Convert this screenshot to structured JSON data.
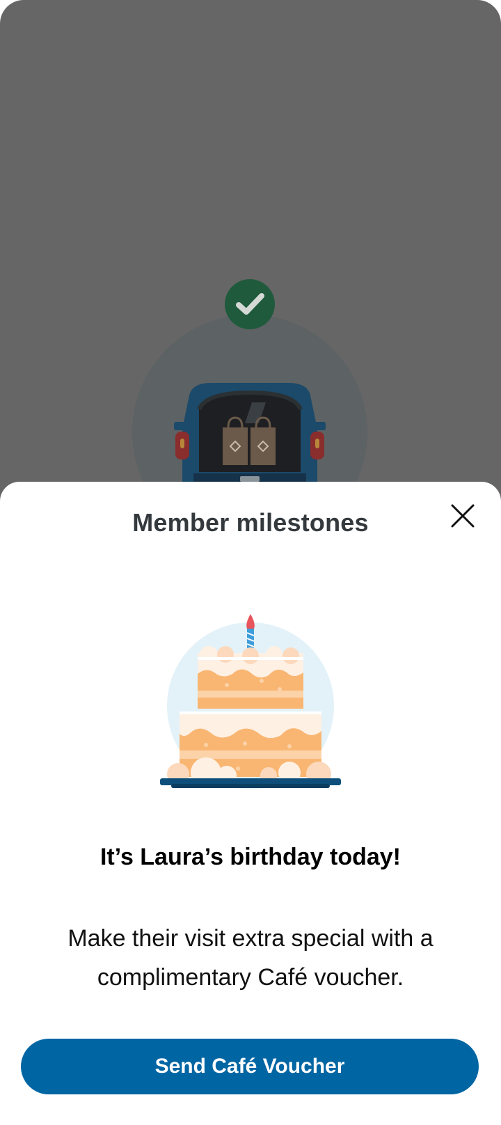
{
  "backdrop": {
    "illustration": "car-trunk-pickup-illustration",
    "badge_icon": "check-icon"
  },
  "sheet": {
    "title": "Member milestones",
    "close_icon": "close-icon",
    "illustration": "birthday-cake-illustration",
    "headline": "It’s Laura’s birthday today!",
    "body": "Make their visit extra special with a complimentary Café voucher.",
    "cta_label": "Send Café Voucher"
  },
  "colors": {
    "backdrop": "#666666",
    "success_badge": "#1f5a3c",
    "primary_button": "#0065a3",
    "title_text": "#33393d"
  }
}
